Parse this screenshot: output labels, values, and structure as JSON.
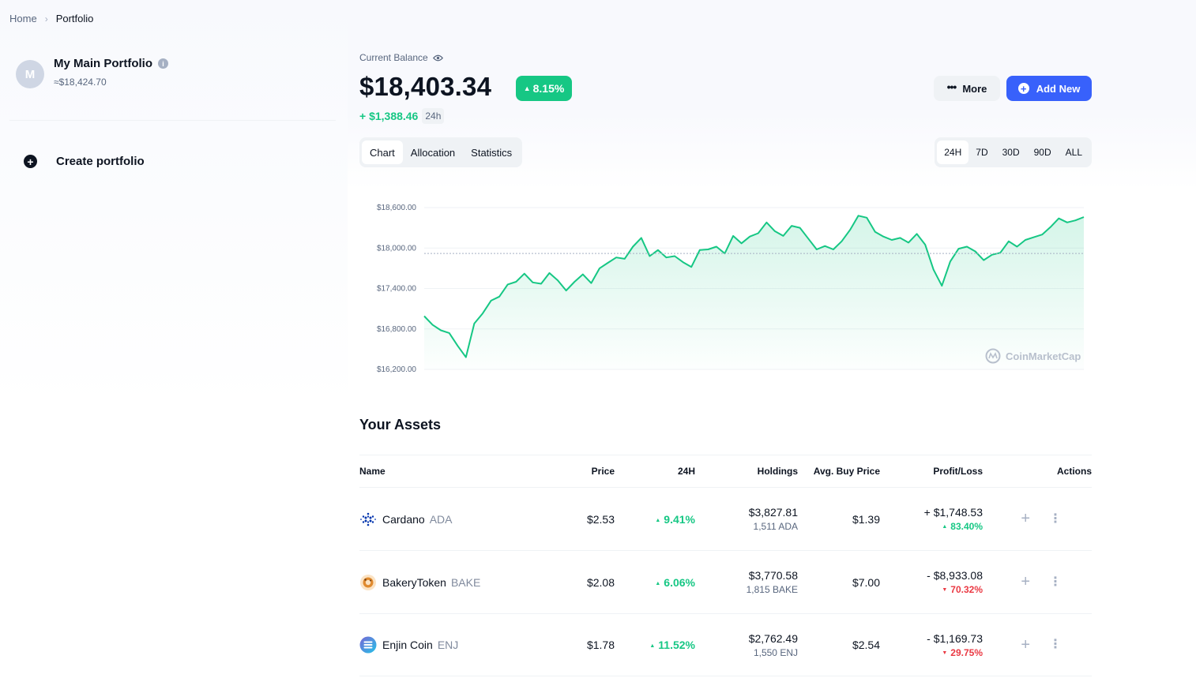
{
  "breadcrumb": {
    "home": "Home",
    "current": "Portfolio"
  },
  "sidebar": {
    "avatar_letter": "M",
    "portfolio_name": "My Main Portfolio",
    "portfolio_value": "≈$18,424.70",
    "create_label": "Create portfolio"
  },
  "balance": {
    "label": "Current Balance",
    "value": "$18,403.34",
    "pct": "8.15%",
    "change": "+ $1,388.46",
    "period": "24h"
  },
  "actions": {
    "more": "More",
    "add_new": "Add New"
  },
  "view_tabs": [
    "Chart",
    "Allocation",
    "Statistics"
  ],
  "range_tabs": [
    "24H",
    "7D",
    "30D",
    "90D",
    "ALL"
  ],
  "watermark": "CoinMarketCap",
  "colors": {
    "accent": "#3861fb",
    "positive": "#16c784",
    "negative": "#ea3943"
  },
  "chart_data": {
    "type": "area",
    "title": "",
    "xlabel": "",
    "ylabel": "",
    "ylim": [
      16200,
      18600
    ],
    "yticks": [
      "$18,600.00",
      "$18,000.00",
      "$17,400.00",
      "$16,800.00",
      "$16,200.00"
    ],
    "series": [
      {
        "values": [
          16990,
          16860,
          16780,
          16740,
          16550,
          16380,
          16880,
          17030,
          17220,
          17280,
          17460,
          17500,
          17620,
          17490,
          17470,
          17630,
          17520,
          17370,
          17500,
          17610,
          17480,
          17700,
          17780,
          17860,
          17840,
          18020,
          18150,
          17880,
          17970,
          17860,
          17880,
          17790,
          17720,
          17970,
          17980,
          18020,
          17920,
          18180,
          18070,
          18170,
          18220,
          18380,
          18250,
          18180,
          18330,
          18300,
          18140,
          17980,
          18030,
          17980,
          18100,
          18270,
          18480,
          18450,
          18240,
          18170,
          18120,
          18150,
          18080,
          18210,
          18050,
          17680,
          17440,
          17800,
          17990,
          18020,
          17950,
          17820,
          17900,
          17930,
          18100,
          18020,
          18120,
          18160,
          18200,
          18310,
          18440,
          18380,
          18410,
          18460
        ]
      }
    ]
  },
  "assets": {
    "title": "Your Assets",
    "columns": [
      "Name",
      "Price",
      "24H",
      "Holdings",
      "Avg. Buy Price",
      "Profit/Loss",
      "Actions"
    ],
    "rows": [
      {
        "name": "Cardano",
        "symbol": "ADA",
        "icon": "cardano-icon",
        "price": "$2.53",
        "change": "9.41%",
        "holdings_value": "$3,827.81",
        "holdings_amount": "1,511 ADA",
        "avg_price": "$1.39",
        "pl_value": "+ $1,748.53",
        "pl_pct": "83.40%",
        "pl_positive": true
      },
      {
        "name": "BakeryToken",
        "symbol": "BAKE",
        "icon": "bakerytoken-icon",
        "price": "$2.08",
        "change": "6.06%",
        "holdings_value": "$3,770.58",
        "holdings_amount": "1,815 BAKE",
        "avg_price": "$7.00",
        "pl_value": "- $8,933.08",
        "pl_pct": "70.32%",
        "pl_positive": false
      },
      {
        "name": "Enjin Coin",
        "symbol": "ENJ",
        "icon": "enjin-icon",
        "price": "$1.78",
        "change": "11.52%",
        "holdings_value": "$2,762.49",
        "holdings_amount": "1,550 ENJ",
        "avg_price": "$2.54",
        "pl_value": "- $1,169.73",
        "pl_pct": "29.75%",
        "pl_positive": false
      }
    ]
  }
}
